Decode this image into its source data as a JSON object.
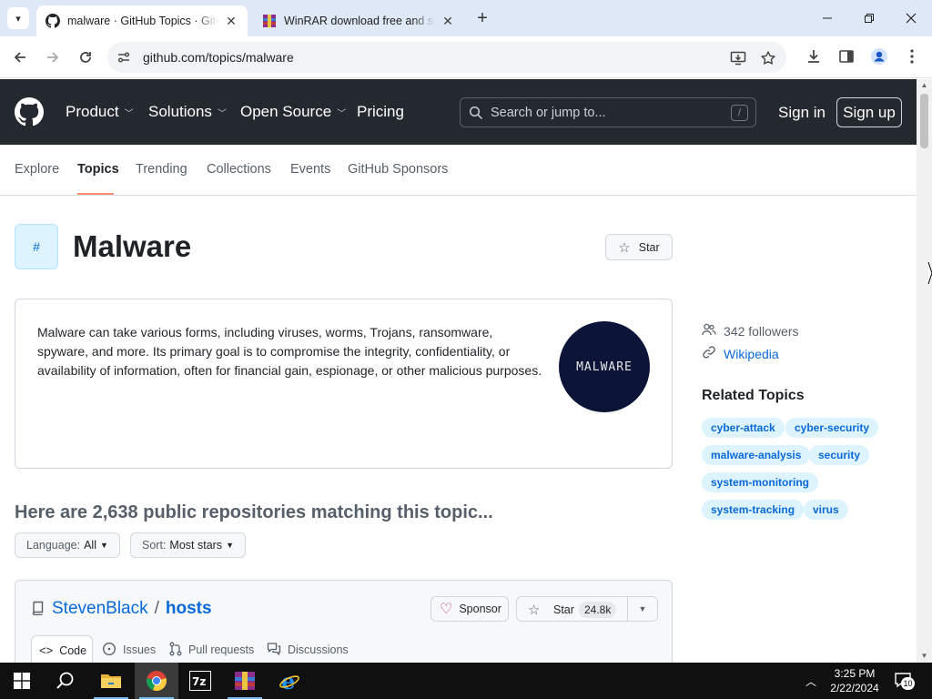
{
  "browser": {
    "tabs": [
      {
        "title": "malware · GitHub Topics · GitHub",
        "active": true
      },
      {
        "title": "WinRAR download free and support",
        "active": false
      }
    ],
    "url": "github.com/topics/malware"
  },
  "header": {
    "nav": [
      "Product",
      "Solutions",
      "Open Source",
      "Pricing"
    ],
    "search_placeholder": "Search or jump to...",
    "search_shortcut": "/",
    "sign_in": "Sign in",
    "sign_up": "Sign up"
  },
  "subnav": {
    "items": [
      "Explore",
      "Topics",
      "Trending",
      "Collections",
      "Events",
      "GitHub Sponsors"
    ],
    "selected": "Topics"
  },
  "topic": {
    "hash": "#",
    "title": "Malware",
    "star_label": "Star",
    "description": "Malware can take various forms, including viruses, worms, Trojans, ransomware, spyware, and more. Its primary goal is to compromise the integrity, confidentiality, or availability of information, often for financial gain, espionage, or other malicious purposes.",
    "logo_text": "MALWARE"
  },
  "sidebar": {
    "followers": "342 followers",
    "wikipedia": "Wikipedia",
    "related_title": "Related Topics",
    "related": [
      "cyber-attack",
      "cyber-security",
      "malware-analysis",
      "security",
      "system-monitoring",
      "system-tracking",
      "virus"
    ]
  },
  "repos": {
    "heading": "Here are 2,638 public repositories matching this topic...",
    "language_label": "Language:",
    "language_value": "All",
    "sort_label": "Sort:",
    "sort_value": "Most stars"
  },
  "repo_card": {
    "owner": "StevenBlack",
    "separator": "/",
    "name": "hosts",
    "sponsor_label": "Sponsor",
    "star_label": "Star",
    "star_count": "24.8k",
    "tabs": [
      "Code",
      "Issues",
      "Pull requests",
      "Discussions"
    ]
  },
  "taskbar": {
    "time": "3:25 PM",
    "date": "2/22/2024",
    "notification_count": "10"
  },
  "colors": {
    "gh_header": "#24292f",
    "link": "#0969da",
    "pill_bg": "#ddf4ff",
    "subnav_accent": "#fd8c73"
  }
}
